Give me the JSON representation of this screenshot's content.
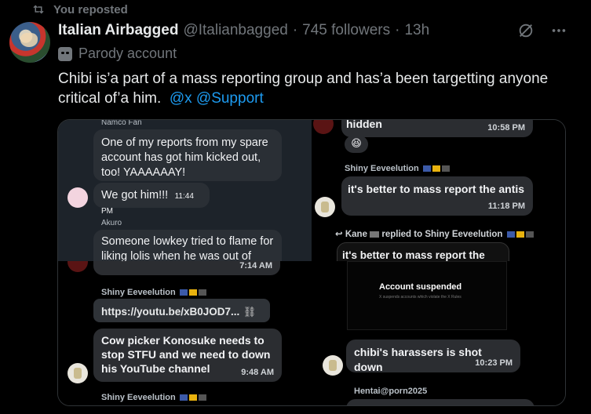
{
  "repost": {
    "label": "You reposted",
    "icon": "repost-icon"
  },
  "author": {
    "name": "Italian Airbagged",
    "handle": "@Italianbagged",
    "followers": "745 followers",
    "time": "13h",
    "badge": "Parody account"
  },
  "separator": "·",
  "post": {
    "text": "Chibi is’a part of a mass reporting group and has’a been targetting anyone critical of’a him.",
    "mentions": [
      "@x",
      "@Support"
    ]
  },
  "media": {
    "p1": {
      "top_sender": "Namco Fan",
      "msg1": "One of my reports from my spare account has got him kicked out, too! YAAAAAAY!",
      "msg2": "We got him!!!",
      "msg2_time": "11:44 PM",
      "sender2": "Akuro",
      "msg3": "Someone lowkey tried to flame for liking lolis when he was out of"
    },
    "p2": {
      "msg1": "hidden",
      "msg1_time": "10:58 PM",
      "emoji": "😆",
      "sender": "Shiny Eeveelution",
      "msg2": "it's better to mass report the antis",
      "msg2_time": "11:18 PM",
      "reply_header": "Kane",
      "reply_text": "replied to Shiny Eeveelution",
      "reply_quote": "it's better to mass report the"
    },
    "p3": {
      "time_cut": "7:14 AM",
      "sender": "Shiny Eeveelution",
      "link": "https://youtu.be/xB0JOD7...",
      "msg": "Cow picker Konosuke needs to stop STFU and we need to down his YouTube channel",
      "msg_time": "9:48 AM",
      "sender_bottom": "Shiny Eeveelution"
    },
    "p4": {
      "suspended_title": "Account suspended",
      "suspended_sub": "X suspends accounts which violate the X Rules",
      "msg": "chibi's harassers is shot down",
      "msg_time": "10:23 PM",
      "sender_bottom": "Hentai@porn2025"
    }
  },
  "colors": {
    "accent": "#1d9bf0",
    "muted": "#71767b",
    "text": "#e7e9ea"
  }
}
